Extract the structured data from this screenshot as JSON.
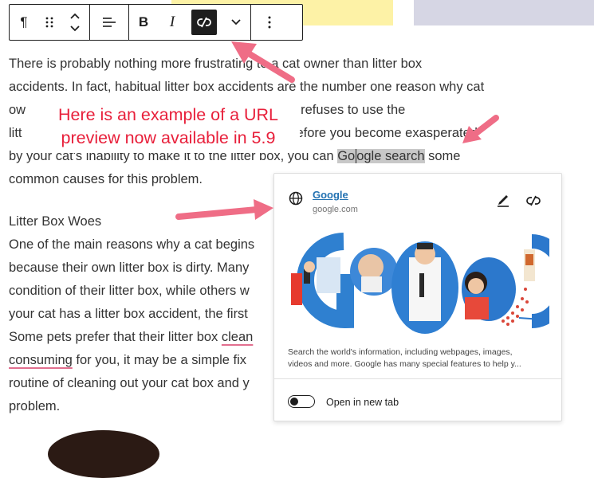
{
  "toolbar": {
    "paragraph_icon": "¶",
    "bold_label": "B",
    "italic_label": "I"
  },
  "paragraphs": {
    "p1": {
      "l1": "There is probably nothing more frustrating to a cat owner than litter box",
      "l2": "accidents. In fact, habitual litter box accidents are the number one reason why cat",
      "l3a": "ow",
      "l3b": "n your cat refuses to use the",
      "l4a": "litt",
      "l4b": "efore you become exasperated",
      "l5": "by your cat's inability to make it to the litter box, you can",
      "link_pre": "Go",
      "link_post": "ogle search",
      "l5_end": "some",
      "l6": "common causes for this problem."
    },
    "heading": "Litter Box Woes",
    "p2": {
      "l1": "One of the main reasons why a cat begins",
      "l2": "because their own litter box is dirty. Many",
      "l3": "condition of their litter box, while others w",
      "l4": "your cat has a litter box accident, the first",
      "l5a": "Some pets prefer that their litter box",
      "l5b": "clean",
      "l6a": "consuming",
      "l6b": "for you, it may be a simple fix",
      "l7": "routine of cleaning out your cat box and y",
      "l8": "problem."
    }
  },
  "callout": {
    "line1": "Here is an example of a URL",
    "line2": "preview now available in 5.9"
  },
  "link_preview": {
    "title": "Google",
    "url": "google.com",
    "description_line1": "Search the world's information, including webpages, images,",
    "description_line2": "videos and more. Google has many special features to help y...",
    "toggle_label": "Open in new tab",
    "open_in_new_tab": false
  },
  "colors": {
    "annotation_red": "#e8203b",
    "arrow_pink": "#ef6d86",
    "link_blue": "#2271b1",
    "selection_gray": "#c8c8c8"
  }
}
